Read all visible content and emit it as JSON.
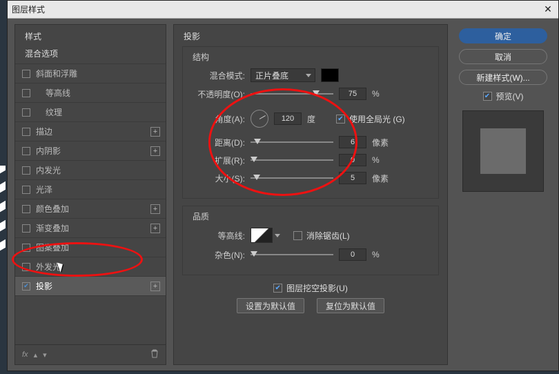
{
  "dialog": {
    "title": "图层样式"
  },
  "left": {
    "styles_header": "样式",
    "blend_options": "混合选项",
    "items": [
      {
        "label": "斜面和浮雕",
        "checked": false,
        "add": false
      },
      {
        "label": "等高线",
        "checked": false,
        "add": false,
        "indent": true
      },
      {
        "label": "纹理",
        "checked": false,
        "add": false,
        "indent": true
      },
      {
        "label": "描边",
        "checked": false,
        "add": true
      },
      {
        "label": "内阴影",
        "checked": false,
        "add": true
      },
      {
        "label": "内发光",
        "checked": false,
        "add": false
      },
      {
        "label": "光泽",
        "checked": false,
        "add": false
      },
      {
        "label": "颜色叠加",
        "checked": false,
        "add": true
      },
      {
        "label": "渐变叠加",
        "checked": false,
        "add": true
      },
      {
        "label": "图案叠加",
        "checked": false,
        "add": false
      },
      {
        "label": "外发光",
        "checked": false,
        "add": false
      },
      {
        "label": "投影",
        "checked": true,
        "add": true,
        "selected": true
      }
    ],
    "fx_label": "fx"
  },
  "mid": {
    "title": "投影",
    "structure": {
      "legend": "结构",
      "blend_mode_label": "混合模式:",
      "blend_mode_value": "正片叠底",
      "opacity_label": "不透明度(O):",
      "opacity_value": "75",
      "opacity_unit": "%",
      "angle_label": "角度(A):",
      "angle_value": "120",
      "angle_unit": "度",
      "global_light_label": "使用全局光 (G)",
      "global_light_checked": true,
      "distance_label": "距离(D):",
      "distance_value": "6",
      "distance_unit": "像素",
      "spread_label": "扩展(R):",
      "spread_value": "0",
      "spread_unit": "%",
      "size_label": "大小(S):",
      "size_value": "5",
      "size_unit": "像素"
    },
    "quality": {
      "legend": "品质",
      "contour_label": "等高线:",
      "antialias_label": "消除锯齿(L)",
      "antialias_checked": false,
      "noise_label": "杂色(N):",
      "noise_value": "0",
      "noise_unit": "%"
    },
    "knockout_label": "图层挖空投影(U)",
    "knockout_checked": true,
    "set_default": "设置为默认值",
    "reset_default": "复位为默认值"
  },
  "right": {
    "ok": "确定",
    "cancel": "取消",
    "new_style": "新建样式(W)...",
    "preview_label": "预览(V)",
    "preview_checked": true
  }
}
